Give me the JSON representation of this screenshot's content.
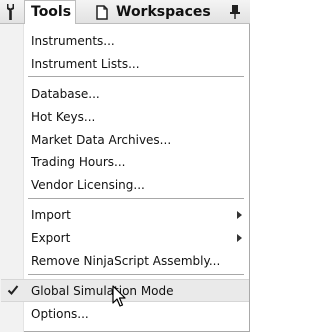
{
  "menubar": {
    "tools_label": "Tools",
    "workspaces_label": "Workspaces"
  },
  "tools_menu": {
    "items": [
      {
        "label": "Instruments..."
      },
      {
        "label": "Instrument Lists..."
      },
      {
        "label": "Database..."
      },
      {
        "label": "Hot Keys..."
      },
      {
        "label": "Market Data Archives..."
      },
      {
        "label": "Trading Hours..."
      },
      {
        "label": "Vendor Licensing..."
      },
      {
        "label": "Import",
        "has_submenu": true
      },
      {
        "label": "Export",
        "has_submenu": true
      },
      {
        "label": "Remove NinjaScript Assembly..."
      },
      {
        "label": "Global Simulation Mode",
        "checked": true,
        "hovered": true
      },
      {
        "label": "Options..."
      }
    ]
  },
  "icons": {
    "tools": "wrench-icon",
    "workspaces": "document-icon",
    "pin": "pin-icon",
    "check": "checkmark-icon",
    "cursor": "mouse-pointer-icon",
    "submenu": "submenu-arrow-icon"
  }
}
